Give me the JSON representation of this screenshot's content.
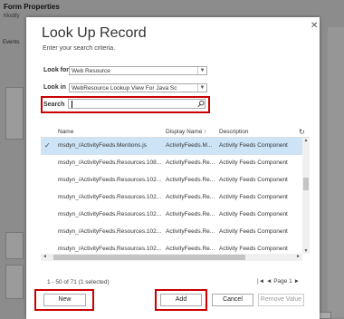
{
  "background": {
    "title": "Form Properties",
    "subtitle": "Modify",
    "events_label": "Events"
  },
  "dialog": {
    "title": "Look Up Record",
    "subtitle": "Enter your search criteria.",
    "close_icon": "close-icon"
  },
  "look_for": {
    "label": "Look for",
    "value": "Web Resource"
  },
  "look_in": {
    "label": "Look in",
    "value": "WebResource Lookup View For Java Sc"
  },
  "search": {
    "label": "Search",
    "value": "",
    "icon": "search-icon"
  },
  "grid": {
    "columns": [
      "Name",
      "Display Name",
      "Description"
    ],
    "sort_indicator": "↑",
    "rows": [
      {
        "name": "msdyn_/ActivityFeeds.Mentions.js",
        "display": "ActivityFeeds.M...",
        "description": "Activity Feeds Component",
        "selected": true
      },
      {
        "name": "msdyn_/ActivityFeeds.Resources.108...",
        "display": "ActivityFeeds.Re...",
        "description": "Activity Feeds Component",
        "selected": false
      },
      {
        "name": "msdyn_/ActivityFeeds.Resources.102...",
        "display": "ActivityFeeds.Re...",
        "description": "Activity Feeds Component",
        "selected": false
      },
      {
        "name": "msdyn_/ActivityFeeds.Resources.102...",
        "display": "ActivityFeeds.Re...",
        "description": "Activity Feeds Component",
        "selected": false
      },
      {
        "name": "msdyn_/ActivityFeeds.Resources.102...",
        "display": "ActivityFeeds.Re...",
        "description": "Activity Feeds Component",
        "selected": false
      },
      {
        "name": "msdyn_/ActivityFeeds.Resources.102...",
        "display": "ActivityFeeds.Re...",
        "description": "Activity Feeds Component",
        "selected": false
      },
      {
        "name": "msdyn_/ActivityFeeds.Resources.102...",
        "display": "ActivityFeeds.Re...",
        "description": "Activity Feeds Component",
        "selected": false
      }
    ]
  },
  "status": "1 - 50 of 71 (1 selected)",
  "pager": {
    "first": "|◄",
    "prev": "◄",
    "page": "Page 1",
    "next": "►"
  },
  "buttons": {
    "new": "New",
    "add": "Add",
    "cancel": "Cancel",
    "remove": "Remove Value"
  },
  "accent": "#cc0000"
}
